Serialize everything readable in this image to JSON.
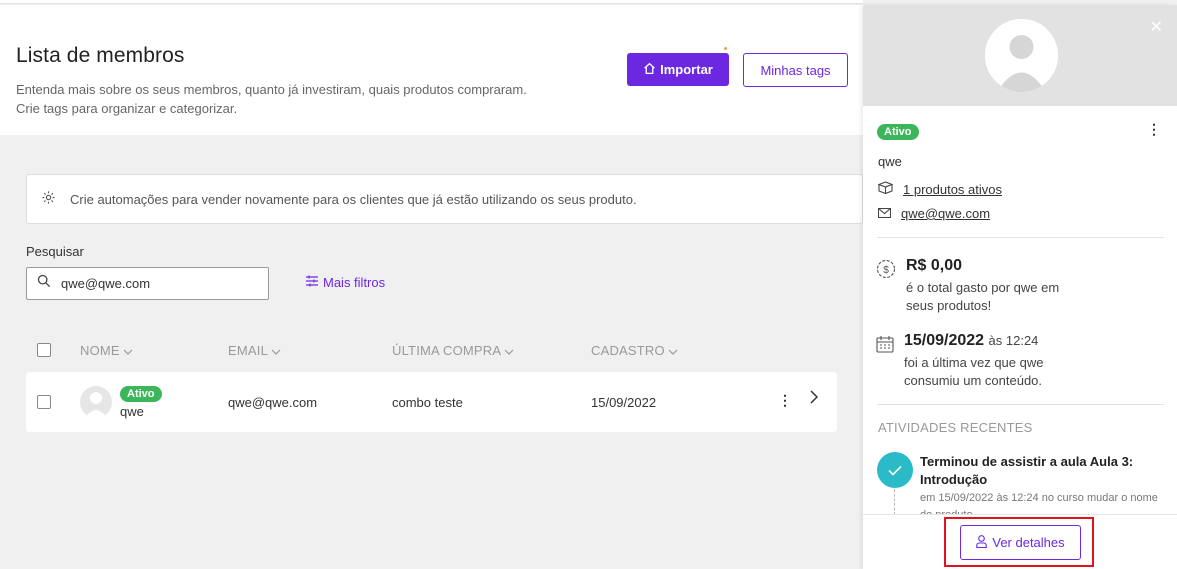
{
  "header": {
    "title": "Lista de membros",
    "subtitle_line1": "Entenda mais sobre os seus membros, quanto já investiram, quais produtos compraram.",
    "subtitle_line2": "Crie tags para organizar e categorizar.",
    "import_label": "Importar",
    "tags_label": "Minhas tags"
  },
  "automation_banner": {
    "icon": "gear-icon",
    "text": "Crie automações para vender novamente para os clientes que já estão utilizando os seus produto."
  },
  "search": {
    "label": "Pesquisar",
    "value": "qwe@qwe.com",
    "more_filters_label": "Mais filtros"
  },
  "table": {
    "columns": [
      "NOME",
      "EMAIL",
      "ÚLTIMA COMPRA",
      "CADASTRO"
    ],
    "rows": [
      {
        "status": "Ativo",
        "name": "qwe",
        "email": "qwe@qwe.com",
        "last_purchase": "combo teste",
        "registered": "15/09/2022"
      }
    ]
  },
  "panel": {
    "status": "Ativo",
    "name": "qwe",
    "products_link": "1 produtos ativos",
    "email": "qwe@qwe.com",
    "total_value": "R$ 0,00",
    "total_text_line1": "é o total gasto por qwe em",
    "total_text_line2": "seus produtos!",
    "last_date": "15/09/2022",
    "last_time": "às 12:24",
    "last_text_line1": "foi a última vez que qwe",
    "last_text_line2": "consumiu um conteúdo.",
    "activities_title": "ATIVIDADES RECENTES",
    "activity_title": "Terminou de assistir a aula Aula 3: Introdução",
    "activity_date": "em 15/09/2022 às 12:24",
    "activity_course": "no curso mudar o nome do produto",
    "details_label": "Ver detalhes"
  },
  "colors": {
    "primary": "#6b28e0",
    "success": "#3db55a",
    "activity": "#2bbbc8",
    "highlight": "#e0141e"
  }
}
